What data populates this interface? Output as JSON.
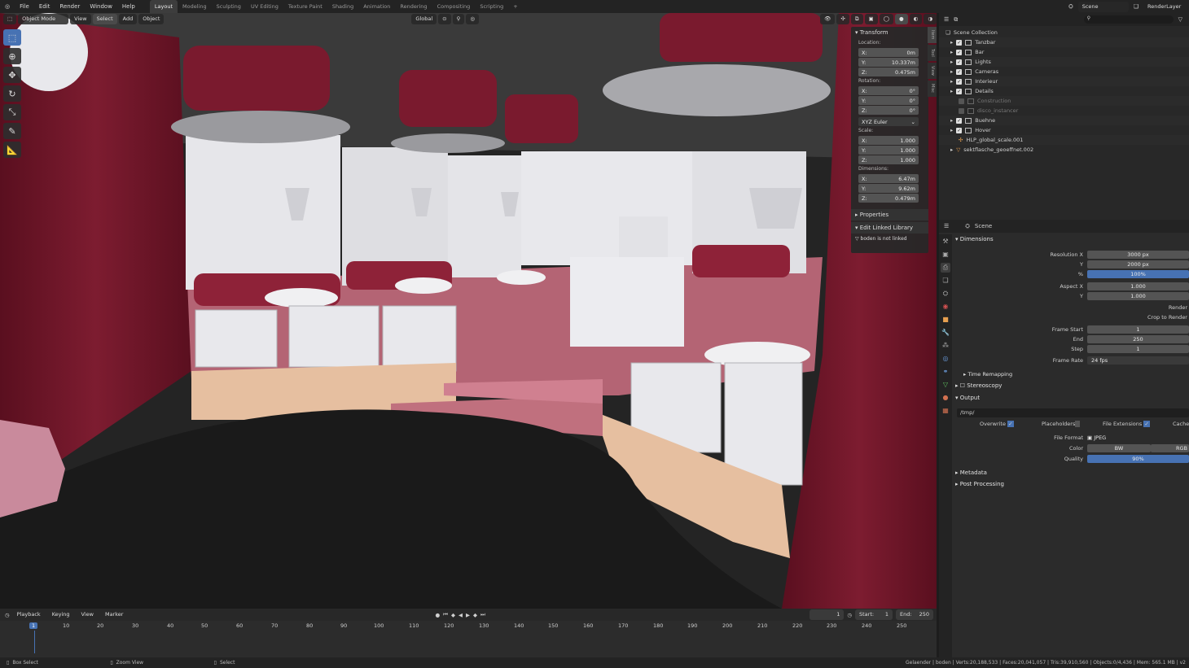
{
  "topbar": {
    "menus": [
      "File",
      "Edit",
      "Render",
      "Window",
      "Help"
    ],
    "workspaces": [
      "Layout",
      "Modeling",
      "Sculpting",
      "UV Editing",
      "Texture Paint",
      "Shading",
      "Animation",
      "Rendering",
      "Compositing",
      "Scripting"
    ],
    "active_workspace": "Layout",
    "add_tab": "+",
    "scene": "Scene",
    "view_layer": "RenderLayer"
  },
  "viewport_header": {
    "mode": "Object Mode",
    "menus": [
      "View",
      "Select",
      "Add",
      "Object"
    ],
    "orientation": "Global"
  },
  "npanel": {
    "transform_title": "Transform",
    "location_label": "Location:",
    "location": [
      {
        "axis": "X:",
        "value": "0m"
      },
      {
        "axis": "Y:",
        "value": "10.337m"
      },
      {
        "axis": "Z:",
        "value": "0.475m"
      }
    ],
    "rotation_label": "Rotation:",
    "rotation": [
      {
        "axis": "X:",
        "value": "0°"
      },
      {
        "axis": "Y:",
        "value": "0°"
      },
      {
        "axis": "Z:",
        "value": "0°"
      }
    ],
    "rotation_mode": "XYZ Euler",
    "scale_label": "Scale:",
    "scale": [
      {
        "axis": "X:",
        "value": "1.000"
      },
      {
        "axis": "Y:",
        "value": "1.000"
      },
      {
        "axis": "Z:",
        "value": "1.000"
      }
    ],
    "dimensions_label": "Dimensions:",
    "dimensions": [
      {
        "axis": "X:",
        "value": "6.47m"
      },
      {
        "axis": "Y:",
        "value": "9.62m"
      },
      {
        "axis": "Z:",
        "value": "0.479m"
      }
    ],
    "properties_title": "Properties",
    "edit_linked_title": "Edit Linked Library",
    "not_linked": "boden is not linked",
    "tabs": [
      "Item",
      "Tool",
      "View",
      "Misc"
    ]
  },
  "outliner": {
    "root": "Scene Collection",
    "items": [
      {
        "name": "Tanzbar",
        "checked": true
      },
      {
        "name": "Bar",
        "checked": true
      },
      {
        "name": "Lights",
        "checked": true
      },
      {
        "name": "Cameras",
        "checked": true
      },
      {
        "name": "Interieur",
        "checked": true
      },
      {
        "name": "Details",
        "checked": true
      },
      {
        "name": "Construction",
        "checked": false
      },
      {
        "name": "disco_instancer",
        "checked": false
      },
      {
        "name": "Buehne",
        "checked": true
      },
      {
        "name": "Hover",
        "checked": true
      },
      {
        "name": "HLP_global_scale.001",
        "checked": null
      },
      {
        "name": "sektflasche_geoeffnet.002",
        "checked": null
      }
    ]
  },
  "properties": {
    "scene_title": "Scene",
    "dimensions_title": "Dimensions",
    "res_x_label": "Resolution X",
    "res_x": "3000 px",
    "res_y_label": "Y",
    "res_y": "2000 px",
    "pct_label": "%",
    "pct": "100%",
    "aspect_x_label": "Aspect X",
    "aspect_x": "1.000",
    "aspect_y_label": "Y",
    "aspect_y": "1.000",
    "render_label": "Render",
    "crop_label": "Crop to Render",
    "frame_start_label": "Frame Start",
    "frame_start": "1",
    "end_label": "End",
    "end": "250",
    "step_label": "Step",
    "step": "1",
    "frame_rate_label": "Frame Rate",
    "frame_rate": "24 fps",
    "time_remapping": "Time Remapping",
    "stereoscopy": "Stereoscopy",
    "output_title": "Output",
    "output_path": "/tmp/",
    "overwrite": "Overwrite",
    "placeholders": "Placeholders",
    "file_extensions": "File Extensions",
    "cache": "Cache",
    "file_format_label": "File Format",
    "file_format": "JPEG",
    "color_label": "Color",
    "color_bw": "BW",
    "color_rgb": "RGB",
    "quality_label": "Quality",
    "quality": "90%",
    "metadata": "Metadata",
    "post_processing": "Post Processing"
  },
  "timeline": {
    "menus": [
      "Playback",
      "Keying",
      "View",
      "Marker"
    ],
    "current_frame": "1",
    "start_label": "Start:",
    "start": "1",
    "end_label": "End:",
    "end": "250",
    "ticks": [
      "10",
      "20",
      "30",
      "40",
      "50",
      "60",
      "70",
      "80",
      "90",
      "100",
      "110",
      "120",
      "130",
      "140",
      "150",
      "160",
      "170",
      "180",
      "190",
      "200",
      "210",
      "220",
      "230",
      "240",
      "250"
    ],
    "playhead": "1"
  },
  "statusbar": {
    "box_select": "Box Select",
    "zoom_view": "Zoom View",
    "select": "Select",
    "stats": "Gelaender | boden | Verts:20,188,533 | Faces:20,041,057 | Tris:39,910,560 | Objects:0/4,436 | Mem: 565.1 MB | v2"
  },
  "colors": {
    "accent": "#4772b3",
    "wall": "#7a1a2e",
    "floor": "#c0707e",
    "stage": "#e6c0a0"
  }
}
